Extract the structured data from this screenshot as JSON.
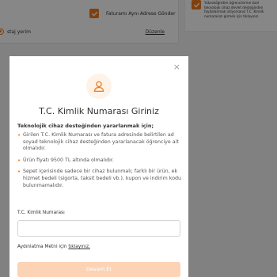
{
  "background": {
    "invoice_checkbox_label": "Faturamı Aynı Adrese Gönder",
    "address_name": "staj yerim",
    "edit_link": "Düzenle",
    "side_note": "Yükseköğretim öğrencilerine özel teknolojik cihaz devlet desteğinden faydalanmak istiyorsanız T.C. Kimlik numaranızı girmek için tıklayınız."
  },
  "modal": {
    "close_label": "×",
    "title": "T.C. Kimlik Numarası Giriniz",
    "subtitle": "Teknolojik cihaz desteğinden yararlanmak için;",
    "requirements": [
      "Girilen T.C. Kimlik Numarası ve fatura adresinde belirtilen ad soyad teknolojik cihaz desteğinden yararlanacak öğrenciye ait olmalıdır.",
      "Ürün fiyatı 9500 TL altında olmalıdır.",
      "Sepet içerisinde sadece bir cihaz bulunmalı; farklı bir ürün, ek hizmet bedeli (sigorta, taksit bedeli vb.), kupon ve indirim kodu bulunmamalıdır."
    ],
    "field_label": "T.C. Kimlik Numarası",
    "input_value": "",
    "input_placeholder": "",
    "consent_prefix": "Aydınlatma Metni için",
    "consent_link": "tıklayınız.",
    "submit_label": "Devam Et"
  },
  "colors": {
    "accent": "#f27a1a",
    "accent_light": "#fff2e6",
    "button_disabled": "#fdd3b5"
  },
  "icons": {
    "checkbox": "check-icon",
    "modal_header": "user-icon",
    "close": "close-icon"
  }
}
